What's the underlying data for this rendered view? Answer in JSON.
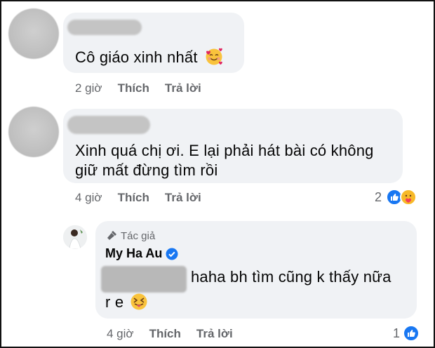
{
  "comments": [
    {
      "text_lines": [
        "Cô giáo xinh nhất"
      ],
      "emoji": "smiling-face-with-hearts-icon",
      "time": "2 giờ",
      "like_label": "Thích",
      "reply_label": "Trả lời"
    },
    {
      "text_lines": [
        "Xinh quá chị ơi. E lại phải hát bài có không",
        "giữ mất đừng tìm rồi"
      ],
      "time": "4 giờ",
      "like_label": "Thích",
      "reply_label": "Trả lời",
      "reaction_count": "2",
      "reactions": [
        "like-icon",
        "care-icon"
      ]
    }
  ],
  "reply": {
    "author_badge": "Tác giả",
    "author_name": "My Ha Au",
    "text_line1": "haha bh tìm cũng k thấy nữa",
    "text_line2": "r e",
    "emoji": "squinting-tongue-face-icon",
    "time": "4 giờ",
    "like_label": "Thích",
    "reply_label": "Trả lời",
    "reaction_count": "1",
    "reactions": [
      "like-icon"
    ]
  },
  "colors": {
    "bubble": "#f0f2f5",
    "meta_text": "#65676b",
    "like_blue": "#1877f2",
    "verified_blue": "#1877f2"
  }
}
